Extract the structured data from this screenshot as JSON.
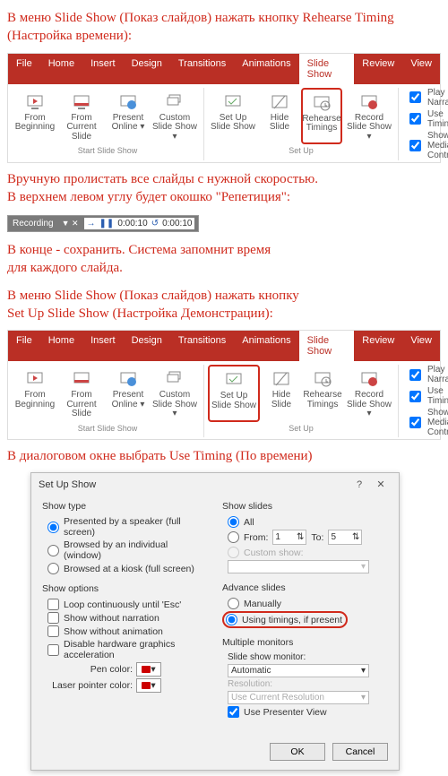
{
  "instr1": "В меню Slide Show (Показ слайдов) нажать кнопку Rehearse Timing (Настройка времени):",
  "instr2a": "Вручную пролистать все слайды с нужной скоростью.",
  "instr2b": "В верхнем левом углу будет окошко \"Репетиция\":",
  "instr3a": "В конце - сохранить. Система запомнит время",
  "instr3b": "для каждого слайда.",
  "instr4a": "В меню Slide Show (Показ слайдов) нажать кнопку",
  "instr4b": "Set Up Slide Show (Настройка Демонстрации):",
  "instr5": "В диалоговом окне  выбрать Use Timing (По времени)",
  "tabs": [
    "File",
    "Home",
    "Insert",
    "Design",
    "Transitions",
    "Animations",
    "Slide Show",
    "Review",
    "View"
  ],
  "ribbon_buttons": {
    "from_beginning": "From Beginning",
    "from_current": "From Current Slide",
    "present_online": "Present Online ▾",
    "custom_show": "Custom Slide Show ▾",
    "setup": "Set Up Slide Show",
    "hide": "Hide Slide",
    "rehearse": "Rehearse Timings",
    "record": "Record Slide Show ▾"
  },
  "grp_start": "Start Slide Show",
  "grp_setup": "Set Up",
  "checks": {
    "play": "Play Narrations",
    "timings": "Use Timings",
    "media": "Show Media Controls"
  },
  "rec": {
    "label": "Recording",
    "t1": "0:00:10",
    "t2": "0:00:10"
  },
  "dlg": {
    "title": "Set Up Show",
    "showtype_h": "Show type",
    "st1": "Presented by a speaker (full screen)",
    "st2": "Browsed by an individual (window)",
    "st3": "Browsed at a kiosk (full screen)",
    "showopt_h": "Show options",
    "o1": "Loop continuously until 'Esc'",
    "o2": "Show without narration",
    "o3": "Show without animation",
    "o4": "Disable hardware graphics acceleration",
    "pen": "Pen color:",
    "laser": "Laser pointer color:",
    "slides_h": "Show slides",
    "all": "All",
    "from": "From:",
    "from_v": "1",
    "to": "To:",
    "to_v": "5",
    "custom": "Custom show:",
    "adv_h": "Advance slides",
    "adv1": "Manually",
    "adv2": "Using timings, if present",
    "mon_h": "Multiple monitors",
    "mon_l": "Slide show monitor:",
    "mon_v": "Automatic",
    "res_l": "Resolution:",
    "res_v": "Use Current Resolution",
    "pv": "Use Presenter View",
    "ok": "OK",
    "cancel": "Cancel"
  }
}
